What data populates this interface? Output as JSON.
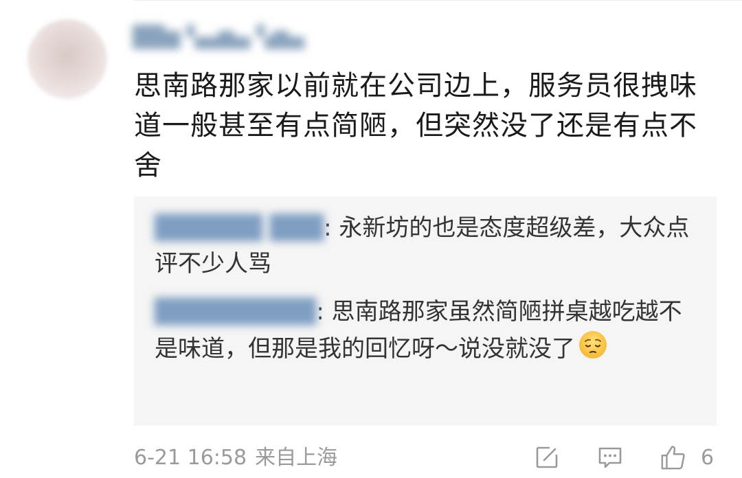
{
  "comment": {
    "username": "██▆ ▚▄▆▄ ▚▆▄",
    "text": "思南路那家以前就在公司边上，服务员很拽味道一般甚至有点简陋，但突然没了还是有点不舍"
  },
  "replies": [
    {
      "user": "██████ ███",
      "text": ": 永新坊的也是态度超级差，大众点评不少人骂"
    },
    {
      "user": "█████████",
      "text": ": 思南路那家虽然简陋拼桌越吃越不是味道，但那是我的回忆呀～说没就没了",
      "emoji": "pensive-face-emoji"
    }
  ],
  "meta": {
    "date": "6-21 16:58",
    "location": "来自上海"
  },
  "actions": {
    "like_count": "6",
    "icons": [
      "edit-icon",
      "comment-icon",
      "thumbs-up-icon"
    ]
  },
  "colors": {
    "reply_background": "#f5f5f5",
    "meta_text": "#9a9a9a",
    "username_blue": "#7f9ec2"
  }
}
